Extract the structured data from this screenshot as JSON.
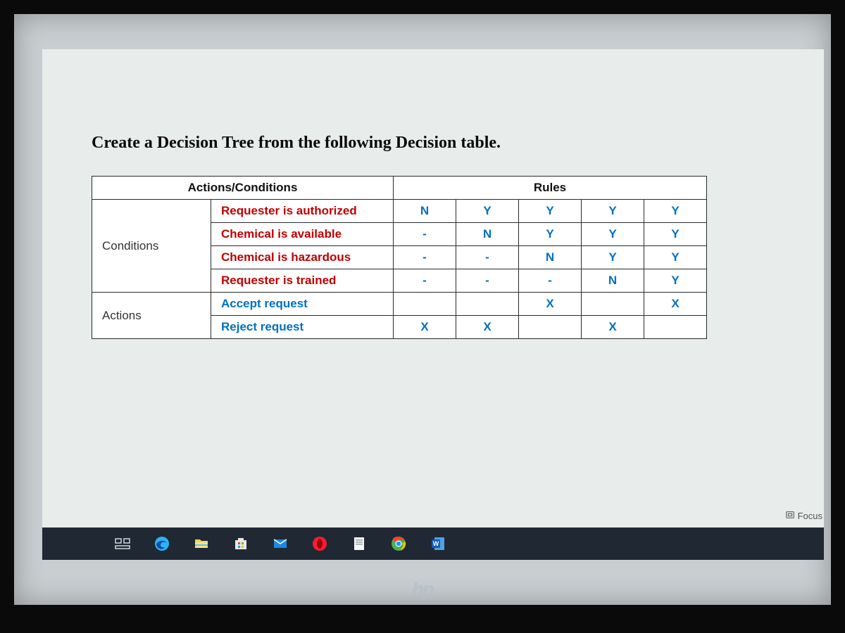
{
  "heading": "Create a Decision Tree from the following Decision table.",
  "table": {
    "head_left": "Actions/Conditions",
    "head_right": "Rules",
    "conditions_label": "Conditions",
    "actions_label": "Actions",
    "conditions": [
      {
        "name": "Requester is authorized",
        "vals": [
          "N",
          "Y",
          "Y",
          "Y",
          "Y"
        ]
      },
      {
        "name": "Chemical is available",
        "vals": [
          "-",
          "N",
          "Y",
          "Y",
          "Y"
        ]
      },
      {
        "name": "Chemical is hazardous",
        "vals": [
          "-",
          "-",
          "N",
          "Y",
          "Y"
        ]
      },
      {
        "name": "Requester is trained",
        "vals": [
          "-",
          "-",
          "-",
          "N",
          "Y"
        ]
      }
    ],
    "actions": [
      {
        "name": "Accept request",
        "vals": [
          "",
          "",
          "X",
          "",
          "X"
        ]
      },
      {
        "name": "Reject request",
        "vals": [
          "X",
          "X",
          "",
          "X",
          ""
        ]
      }
    ]
  },
  "statusbar": {
    "focus": "Focus"
  },
  "taskbar_icons": [
    "task-view-icon",
    "edge-icon",
    "file-explorer-icon",
    "ms-store-icon",
    "mail-icon",
    "opera-icon",
    "word-doc-icon",
    "chrome-icon",
    "word-app-icon"
  ],
  "brand": "hp"
}
